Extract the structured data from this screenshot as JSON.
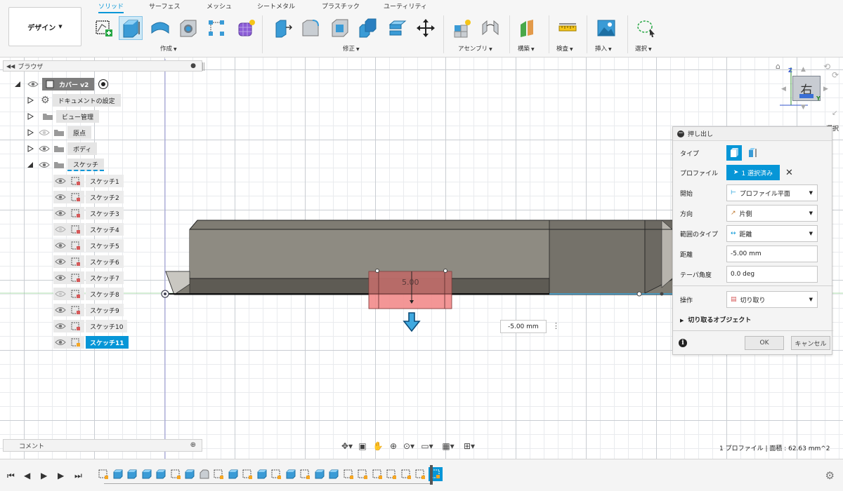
{
  "app": {
    "design_label": "デザイン",
    "tabs": [
      "ソリッド",
      "サーフェス",
      "メッシュ",
      "シートメタル",
      "プラスチック",
      "ユーティリティ"
    ],
    "groups": [
      "作成",
      "修正",
      "アセンブリ",
      "構築",
      "検査",
      "挿入",
      "選択"
    ]
  },
  "browser": {
    "title": "ブラウザ",
    "root": "カバー v2",
    "items": [
      "ドキュメントの設定",
      "ビュー管理",
      "原点",
      "ボディ",
      "スケッチ"
    ],
    "sketches": [
      "スケッチ1",
      "スケッチ2",
      "スケッチ3",
      "スケッチ4",
      "スケッチ5",
      "スケッチ6",
      "スケッチ7",
      "スケッチ8",
      "スケッチ9",
      "スケッチ10",
      "スケッチ11"
    ],
    "active_sketch_index": 10
  },
  "comment": {
    "label": "コメント"
  },
  "canvas": {
    "dimension_label": "5.00",
    "distance_input": "-5.00 mm",
    "view_label": "右",
    "select_tip": "選択"
  },
  "extrude_dialog": {
    "title": "押し出し",
    "type_label": "タイプ",
    "profile_label": "プロファイル",
    "profile_value": "1 選択済み",
    "start_label": "開始",
    "start_value": "プロファイル平面",
    "direction_label": "方向",
    "direction_value": "片側",
    "extent_label": "範囲のタイプ",
    "extent_value": "距離",
    "distance_label": "距離",
    "distance_value": "-5.00 mm",
    "taper_label": "テーパ角度",
    "taper_value": "0.0 deg",
    "operation_label": "操作",
    "operation_value": "切り取り",
    "objects_label": "切り取るオブジェクト",
    "ok_label": "OK",
    "cancel_label": "キャンセル"
  },
  "status": {
    "text": "1 プロファイル | 面積 : 62.63 mm^2"
  },
  "colors": {
    "accent": "#0696d7",
    "body_face": "#7f7c73",
    "cut_profile": "#f28b8b"
  }
}
